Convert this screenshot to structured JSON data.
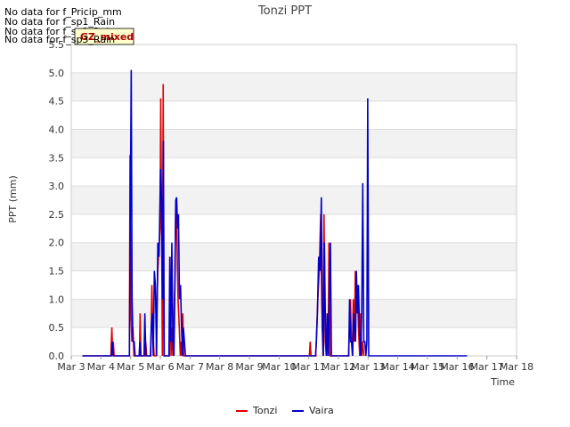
{
  "no_data_messages": [
    "No data for f_Pricip_mm",
    "No data for f_sp1_Rain",
    "No data for f_sp2_Rain",
    "No data for f_sp3_Rain"
  ],
  "badge": {
    "label": "GZ_mixed"
  },
  "chart_data": {
    "type": "line",
    "title": "Tonzi PPT",
    "xlabel": "Time",
    "ylabel": "PPT (mm)",
    "x_ticks": [
      "Mar 3",
      "Mar 4",
      "Mar 5",
      "Mar 6",
      "Mar 7",
      "Mar 8",
      "Mar 9",
      "Mar 10",
      "Mar 11",
      "Mar 12",
      "Mar 13",
      "Mar 14",
      "Mar 15",
      "Mar 16",
      "Mar 17",
      "Mar 18"
    ],
    "y_ticks": [
      "0.0",
      "0.5",
      "1.0",
      "1.5",
      "2.0",
      "2.5",
      "3.0",
      "3.5",
      "4.0",
      "4.5",
      "5.0",
      "5.5"
    ],
    "xlim": [
      "2024-03-03",
      "2024-03-18"
    ],
    "ylim": [
      0,
      5.5
    ],
    "grid": "horizontal bands",
    "legend_position": "bottom-center",
    "series": [
      {
        "name": "Tonzi",
        "color": "#dd0000",
        "points": [
          [
            "2024-03-03T09:00",
            0
          ],
          [
            "2024-03-04T08:00",
            0
          ],
          [
            "2024-03-04T08:50",
            0.5
          ],
          [
            "2024-03-04T09:30",
            0
          ],
          [
            "2024-03-04T10:00",
            0.25
          ],
          [
            "2024-03-04T10:40",
            0
          ],
          [
            "2024-03-04T23:00",
            0
          ],
          [
            "2024-03-04T23:30",
            3.55
          ],
          [
            "2024-03-05T00:20",
            0.75
          ],
          [
            "2024-03-05T01:00",
            0.25
          ],
          [
            "2024-03-05T01:50",
            0.5
          ],
          [
            "2024-03-05T02:40",
            0
          ],
          [
            "2024-03-05T07:10",
            0
          ],
          [
            "2024-03-05T07:40",
            0.75
          ],
          [
            "2024-03-05T08:20",
            0
          ],
          [
            "2024-03-05T11:30",
            0
          ],
          [
            "2024-03-05T12:10",
            0.25
          ],
          [
            "2024-03-05T13:00",
            0
          ],
          [
            "2024-03-05T16:20",
            0
          ],
          [
            "2024-03-05T17:10",
            1.25
          ],
          [
            "2024-03-05T17:50",
            0.5
          ],
          [
            "2024-03-05T19:00",
            0
          ],
          [
            "2024-03-05T20:40",
            0
          ],
          [
            "2024-03-05T21:10",
            0.75
          ],
          [
            "2024-03-05T22:00",
            1.5
          ],
          [
            "2024-03-05T23:10",
            2.0
          ],
          [
            "2024-03-05T23:50",
            2.25
          ],
          [
            "2024-03-06T00:20",
            4.55
          ],
          [
            "2024-03-06T01:00",
            2.5
          ],
          [
            "2024-03-06T01:40",
            0
          ],
          [
            "2024-03-06T02:20",
            4.8
          ],
          [
            "2024-03-06T03:00",
            0
          ],
          [
            "2024-03-06T07:20",
            0
          ],
          [
            "2024-03-06T07:50",
            1.75
          ],
          [
            "2024-03-06T08:40",
            0
          ],
          [
            "2024-03-06T09:20",
            0.5
          ],
          [
            "2024-03-06T10:10",
            0
          ],
          [
            "2024-03-06T10:50",
            0.5
          ],
          [
            "2024-03-06T11:40",
            1.25
          ],
          [
            "2024-03-06T12:30",
            2.75
          ],
          [
            "2024-03-06T13:20",
            2.25
          ],
          [
            "2024-03-06T14:20",
            1.0
          ],
          [
            "2024-03-06T15:20",
            0.5
          ],
          [
            "2024-03-06T16:10",
            0
          ],
          [
            "2024-03-06T16:50",
            0.25
          ],
          [
            "2024-03-06T17:30",
            0
          ],
          [
            "2024-03-06T18:10",
            0.75
          ],
          [
            "2024-03-06T18:50",
            0
          ],
          [
            "2024-03-11T00:30",
            0
          ],
          [
            "2024-03-11T01:10",
            0.25
          ],
          [
            "2024-03-11T01:50",
            0
          ],
          [
            "2024-03-11T05:40",
            0
          ],
          [
            "2024-03-11T06:30",
            0.5
          ],
          [
            "2024-03-11T07:20",
            1.0
          ],
          [
            "2024-03-11T08:30",
            1.5
          ],
          [
            "2024-03-11T09:40",
            2.5
          ],
          [
            "2024-03-11T10:30",
            1.0
          ],
          [
            "2024-03-11T11:30",
            0
          ],
          [
            "2024-03-11T12:20",
            2.5
          ],
          [
            "2024-03-11T13:20",
            0.25
          ],
          [
            "2024-03-11T14:10",
            0
          ],
          [
            "2024-03-11T14:50",
            0.75
          ],
          [
            "2024-03-11T15:40",
            0
          ],
          [
            "2024-03-11T16:20",
            2.0
          ],
          [
            "2024-03-11T17:10",
            0
          ],
          [
            "2024-03-12T08:10",
            0
          ],
          [
            "2024-03-12T08:50",
            0.5
          ],
          [
            "2024-03-12T09:40",
            1.0
          ],
          [
            "2024-03-12T10:30",
            0.25
          ],
          [
            "2024-03-12T11:20",
            0
          ],
          [
            "2024-03-12T12:00",
            1.0
          ],
          [
            "2024-03-12T12:50",
            0.25
          ],
          [
            "2024-03-12T13:40",
            1.5
          ],
          [
            "2024-03-12T14:30",
            0.75
          ],
          [
            "2024-03-12T15:20",
            1.25
          ],
          [
            "2024-03-12T16:10",
            0.5
          ],
          [
            "2024-03-12T17:10",
            0
          ],
          [
            "2024-03-12T18:00",
            0.75
          ],
          [
            "2024-03-12T18:50",
            0
          ],
          [
            "2024-03-12T19:40",
            0.25
          ],
          [
            "2024-03-12T20:30",
            0
          ]
        ]
      },
      {
        "name": "Vaira",
        "color": "#0000cc",
        "points": [
          [
            "2024-03-03T09:00",
            0
          ],
          [
            "2024-03-04T08:30",
            0
          ],
          [
            "2024-03-04T09:10",
            0.25
          ],
          [
            "2024-03-04T10:00",
            0
          ],
          [
            "2024-03-04T23:00",
            0
          ],
          [
            "2024-03-04T23:40",
            2.25
          ],
          [
            "2024-03-05T00:30",
            5.05
          ],
          [
            "2024-03-05T01:10",
            1.0
          ],
          [
            "2024-03-05T02:00",
            0.25
          ],
          [
            "2024-03-05T02:50",
            0.25
          ],
          [
            "2024-03-05T03:40",
            0
          ],
          [
            "2024-03-05T06:50",
            0
          ],
          [
            "2024-03-05T07:30",
            0.25
          ],
          [
            "2024-03-05T08:10",
            0
          ],
          [
            "2024-03-05T10:50",
            0
          ],
          [
            "2024-03-05T11:30",
            0.75
          ],
          [
            "2024-03-05T12:20",
            0
          ],
          [
            "2024-03-05T16:00",
            0
          ],
          [
            "2024-03-05T16:40",
            0.5
          ],
          [
            "2024-03-05T17:30",
            0.75
          ],
          [
            "2024-03-05T18:20",
            0
          ],
          [
            "2024-03-05T19:10",
            1.5
          ],
          [
            "2024-03-05T20:00",
            1.25
          ],
          [
            "2024-03-05T21:00",
            0
          ],
          [
            "2024-03-05T22:00",
            2.0
          ],
          [
            "2024-03-05T23:00",
            1.75
          ],
          [
            "2024-03-06T00:10",
            3.3
          ],
          [
            "2024-03-06T01:00",
            2.75
          ],
          [
            "2024-03-06T01:50",
            1.0
          ],
          [
            "2024-03-06T02:30",
            3.8
          ],
          [
            "2024-03-06T03:10",
            0
          ],
          [
            "2024-03-06T07:00",
            0
          ],
          [
            "2024-03-06T07:40",
            1.75
          ],
          [
            "2024-03-06T08:30",
            0.25
          ],
          [
            "2024-03-06T09:20",
            2.0
          ],
          [
            "2024-03-06T10:10",
            0.25
          ],
          [
            "2024-03-06T11:00",
            0
          ],
          [
            "2024-03-06T11:50",
            1.25
          ],
          [
            "2024-03-06T12:30",
            2.75
          ],
          [
            "2024-03-06T13:10",
            2.8
          ],
          [
            "2024-03-06T14:00",
            2.25
          ],
          [
            "2024-03-06T14:40",
            2.5
          ],
          [
            "2024-03-06T15:30",
            1.0
          ],
          [
            "2024-03-06T16:20",
            1.25
          ],
          [
            "2024-03-06T17:10",
            0.5
          ],
          [
            "2024-03-06T18:00",
            0
          ],
          [
            "2024-03-06T18:40",
            0.5
          ],
          [
            "2024-03-06T19:30",
            0.25
          ],
          [
            "2024-03-06T20:20",
            0
          ],
          [
            "2024-03-11T05:30",
            0
          ],
          [
            "2024-03-11T06:10",
            0.25
          ],
          [
            "2024-03-11T07:00",
            0.75
          ],
          [
            "2024-03-11T08:00",
            1.75
          ],
          [
            "2024-03-11T09:10",
            1.5
          ],
          [
            "2024-03-11T10:10",
            2.8
          ],
          [
            "2024-03-11T11:00",
            0.5
          ],
          [
            "2024-03-11T11:50",
            0
          ],
          [
            "2024-03-11T12:40",
            2.0
          ],
          [
            "2024-03-11T13:30",
            0.5
          ],
          [
            "2024-03-11T14:20",
            0
          ],
          [
            "2024-03-11T15:00",
            0.75
          ],
          [
            "2024-03-11T15:50",
            0
          ],
          [
            "2024-03-11T16:40",
            1.0
          ],
          [
            "2024-03-11T17:30",
            2.0
          ],
          [
            "2024-03-11T18:20",
            0
          ],
          [
            "2024-03-12T08:20",
            0
          ],
          [
            "2024-03-12T09:00",
            1.0
          ],
          [
            "2024-03-12T09:50",
            0.25
          ],
          [
            "2024-03-12T10:40",
            0.25
          ],
          [
            "2024-03-12T11:30",
            0
          ],
          [
            "2024-03-12T12:10",
            0.75
          ],
          [
            "2024-03-12T13:00",
            0.5
          ],
          [
            "2024-03-12T13:50",
            0.25
          ],
          [
            "2024-03-12T14:30",
            1.5
          ],
          [
            "2024-03-12T15:20",
            0.75
          ],
          [
            "2024-03-12T16:10",
            1.25
          ],
          [
            "2024-03-12T17:00",
            0.5
          ],
          [
            "2024-03-12T18:00",
            0
          ],
          [
            "2024-03-12T18:50",
            0.75
          ],
          [
            "2024-03-12T19:40",
            3.05
          ],
          [
            "2024-03-12T20:30",
            0.25
          ],
          [
            "2024-03-12T21:20",
            0.25
          ],
          [
            "2024-03-12T22:10",
            0
          ],
          [
            "2024-03-12T23:00",
            0.25
          ],
          [
            "2024-03-12T23:40",
            4.55
          ],
          [
            "2024-03-13T00:30",
            0
          ],
          [
            "2024-03-16T08:00",
            0
          ]
        ]
      }
    ]
  }
}
